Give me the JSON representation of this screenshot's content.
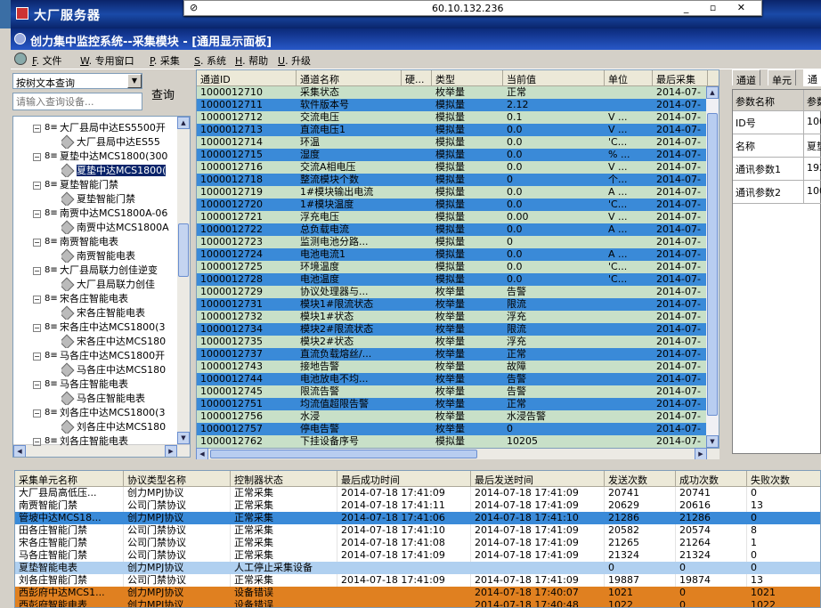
{
  "outer_title": "大厂服务器",
  "remote": {
    "ip": "60.10.132.236",
    "pin": "⊘",
    "controls": "_ ▫ ✕"
  },
  "inner_title": "创力集中监控系统--采集模块 - [通用显示面板]",
  "menu": [
    {
      "key": "F",
      "label": "文件"
    },
    {
      "key": "W",
      "label": "专用窗口"
    },
    {
      "key": "P",
      "label": "采集"
    },
    {
      "key": "S",
      "label": "系统"
    },
    {
      "key": "H",
      "label": "帮助"
    },
    {
      "key": "U",
      "label": "升级"
    }
  ],
  "search": {
    "mode": "按树文本查询",
    "placeholder": "请输入查询设备...",
    "button": "查询"
  },
  "tree": [
    {
      "level": 0,
      "label": "大厂县局中达ES5500开"
    },
    {
      "level": 1,
      "label": "大厂县局中达ES55"
    },
    {
      "level": 0,
      "label": "夏垫中达MCS1800(300"
    },
    {
      "level": 1,
      "label": "夏垫中达MCS1800(",
      "selected": true
    },
    {
      "level": 0,
      "label": "夏垫智能门禁"
    },
    {
      "level": 1,
      "label": "夏垫智能门禁"
    },
    {
      "level": 0,
      "label": "南贾中达MCS1800A-06"
    },
    {
      "level": 1,
      "label": "南贾中达MCS1800A"
    },
    {
      "level": 0,
      "label": "南贾智能电表"
    },
    {
      "level": 1,
      "label": "南贾智能电表"
    },
    {
      "level": 0,
      "label": "大厂县局联力创佳逆变"
    },
    {
      "level": 1,
      "label": "大厂县局联力创佳"
    },
    {
      "level": 0,
      "label": "宋各庄智能电表"
    },
    {
      "level": 1,
      "label": "宋各庄智能电表"
    },
    {
      "level": 0,
      "label": "宋各庄中达MCS1800(3"
    },
    {
      "level": 1,
      "label": "宋各庄中达MCS180"
    },
    {
      "level": 0,
      "label": "马各庄中达MCS1800开"
    },
    {
      "level": 1,
      "label": "马各庄中达MCS180"
    },
    {
      "level": 0,
      "label": "马各庄智能电表"
    },
    {
      "level": 1,
      "label": "马各庄智能电表"
    },
    {
      "level": 0,
      "label": "刘各庄中达MCS1800(3"
    },
    {
      "level": 1,
      "label": "刘各庄中达MCS180"
    },
    {
      "level": 0,
      "label": "刘各庄智能电表"
    }
  ],
  "grid": {
    "columns": [
      "通道ID",
      "通道名称",
      "硬...",
      "类型",
      "当前值",
      "单位",
      "最后采集"
    ],
    "rows": [
      [
        "1000012710",
        "采集状态",
        "",
        "枚举量",
        "正常",
        "",
        "2014-07-"
      ],
      [
        "1000012711",
        "软件版本号",
        "",
        "模拟量",
        "2.12",
        "",
        "2014-07-"
      ],
      [
        "1000012712",
        "交流电压",
        "",
        "模拟量",
        "0.1",
        "V ...",
        "2014-07-"
      ],
      [
        "1000012713",
        "直流电压1",
        "",
        "模拟量",
        "0.0",
        "V ...",
        "2014-07-"
      ],
      [
        "1000012714",
        "环温",
        "",
        "模拟量",
        "0.0",
        "'C...",
        "2014-07-"
      ],
      [
        "1000012715",
        "湿度",
        "",
        "模拟量",
        "0.0",
        "% ...",
        "2014-07-"
      ],
      [
        "1000012716",
        "交流A相电压",
        "",
        "模拟量",
        "0.0",
        "V ...",
        "2014-07-"
      ],
      [
        "1000012718",
        "整流模块个数",
        "",
        "模拟量",
        "0",
        "个...",
        "2014-07-"
      ],
      [
        "1000012719",
        "1#模块输出电流",
        "",
        "模拟量",
        "0.0",
        "A ...",
        "2014-07-"
      ],
      [
        "1000012720",
        "1#模块温度",
        "",
        "模拟量",
        "0.0",
        "'C...",
        "2014-07-"
      ],
      [
        "1000012721",
        "浮充电压",
        "",
        "模拟量",
        "0.00",
        "V ...",
        "2014-07-"
      ],
      [
        "1000012722",
        "总负载电流",
        "",
        "模拟量",
        "0.0",
        "A ...",
        "2014-07-"
      ],
      [
        "1000012723",
        "监测电池分路...",
        "",
        "模拟量",
        "0",
        "",
        "2014-07-"
      ],
      [
        "1000012724",
        "电池电流1",
        "",
        "模拟量",
        "0.0",
        "A ...",
        "2014-07-"
      ],
      [
        "1000012725",
        "环境温度",
        "",
        "模拟量",
        "0.0",
        "'C...",
        "2014-07-"
      ],
      [
        "1000012728",
        "电池温度",
        "",
        "模拟量",
        "0.0",
        "'C...",
        "2014-07-"
      ],
      [
        "1000012729",
        "协议处理器与...",
        "",
        "枚举量",
        "告警",
        "",
        "2014-07-"
      ],
      [
        "1000012731",
        "模块1#限流状态",
        "",
        "枚举量",
        "限流",
        "",
        "2014-07-"
      ],
      [
        "1000012732",
        "模块1#状态",
        "",
        "枚举量",
        "浮充",
        "",
        "2014-07-"
      ],
      [
        "1000012734",
        "模块2#限流状态",
        "",
        "枚举量",
        "限流",
        "",
        "2014-07-"
      ],
      [
        "1000012735",
        "模块2#状态",
        "",
        "枚举量",
        "浮充",
        "",
        "2014-07-"
      ],
      [
        "1000012737",
        "直流负载熔丝/...",
        "",
        "枚举量",
        "正常",
        "",
        "2014-07-"
      ],
      [
        "1000012743",
        "接地告警",
        "",
        "枚举量",
        "故障",
        "",
        "2014-07-"
      ],
      [
        "1000012744",
        "电池放电不均...",
        "",
        "枚举量",
        "告警",
        "",
        "2014-07-"
      ],
      [
        "1000012745",
        "限流告警",
        "",
        "枚举量",
        "告警",
        "",
        "2014-07-"
      ],
      [
        "1000012751",
        "均流值超限告警",
        "",
        "枚举量",
        "正常",
        "",
        "2014-07-"
      ],
      [
        "1000012756",
        "水浸",
        "",
        "枚举量",
        "水浸告警",
        "",
        "2014-07-"
      ],
      [
        "1000012757",
        "停电告警",
        "",
        "枚举量",
        "0",
        "",
        "2014-07-"
      ],
      [
        "1000012762",
        "下挂设备序号",
        "",
        "模拟量",
        "10205",
        "",
        "2014-07-"
      ]
    ]
  },
  "right_panel": {
    "tabs": [
      "通道",
      "单元",
      "通"
    ],
    "header": [
      "参数名称",
      "参数"
    ],
    "rows": [
      [
        "ID号",
        "100"
      ],
      [
        "名称",
        "夏垫"
      ],
      [
        "通讯参数1",
        "192"
      ],
      [
        "通讯参数2",
        "100"
      ]
    ]
  },
  "bottom": {
    "columns": [
      "采集单元名称",
      "协议类型名称",
      "控制器状态",
      "最后成功时间",
      "最后发送时间",
      "发送次数",
      "成功次数",
      "失败次数"
    ],
    "rows": [
      {
        "status": "normal",
        "cells": [
          "大厂县局高低压...",
          "创力MPJ协议",
          "正常采集",
          "2014-07-18 17:41:09",
          "2014-07-18 17:41:09",
          "20741",
          "20741",
          "0"
        ]
      },
      {
        "status": "normal",
        "cells": [
          "南贾智能门禁",
          "公司门禁协议",
          "正常采集",
          "2014-07-18 17:41:11",
          "2014-07-18 17:41:09",
          "20629",
          "20616",
          "13"
        ]
      },
      {
        "status": "selected",
        "cells": [
          "管坡中达MCS18...",
          "创力MPJ协议",
          "正常采集",
          "2014-07-18 17:41:06",
          "2014-07-18 17:41:10",
          "21286",
          "21286",
          "0"
        ]
      },
      {
        "status": "normal",
        "cells": [
          "田各庄智能门禁",
          "公司门禁协议",
          "正常采集",
          "2014-07-18 17:41:10",
          "2014-07-18 17:41:09",
          "20582",
          "20574",
          "8"
        ]
      },
      {
        "status": "normal",
        "cells": [
          "宋各庄智能门禁",
          "公司门禁协议",
          "正常采集",
          "2014-07-18 17:41:08",
          "2014-07-18 17:41:09",
          "21265",
          "21264",
          "1"
        ]
      },
      {
        "status": "normal",
        "cells": [
          "马各庄智能门禁",
          "公司门禁协议",
          "正常采集",
          "2014-07-18 17:41:09",
          "2014-07-18 17:41:09",
          "21324",
          "21324",
          "0"
        ]
      },
      {
        "status": "stopped",
        "cells": [
          "夏垫智能电表",
          "创力MPJ协议",
          "人工停止采集设备",
          "",
          "",
          "0",
          "0",
          "0"
        ]
      },
      {
        "status": "normal",
        "cells": [
          "刘各庄智能门禁",
          "公司门禁协议",
          "正常采集",
          "2014-07-18 17:41:09",
          "2014-07-18 17:41:09",
          "19887",
          "19874",
          "13"
        ]
      },
      {
        "status": "error",
        "cells": [
          "西彭府中达MCS1...",
          "创力MPJ协议",
          "设备错误",
          "",
          "2014-07-18 17:40:07",
          "1021",
          "0",
          "1021"
        ]
      },
      {
        "status": "error",
        "cells": [
          "西彭府智能电表",
          "创力MPJ协议",
          "设备错误",
          "",
          "2014-07-18 17:40:48",
          "1022",
          "0",
          "1022"
        ]
      }
    ]
  },
  "colors": {
    "row_green": "#c8e0c8",
    "row_blue": "#3a8ad8",
    "error": "#e08020",
    "title": "#0a246a"
  }
}
